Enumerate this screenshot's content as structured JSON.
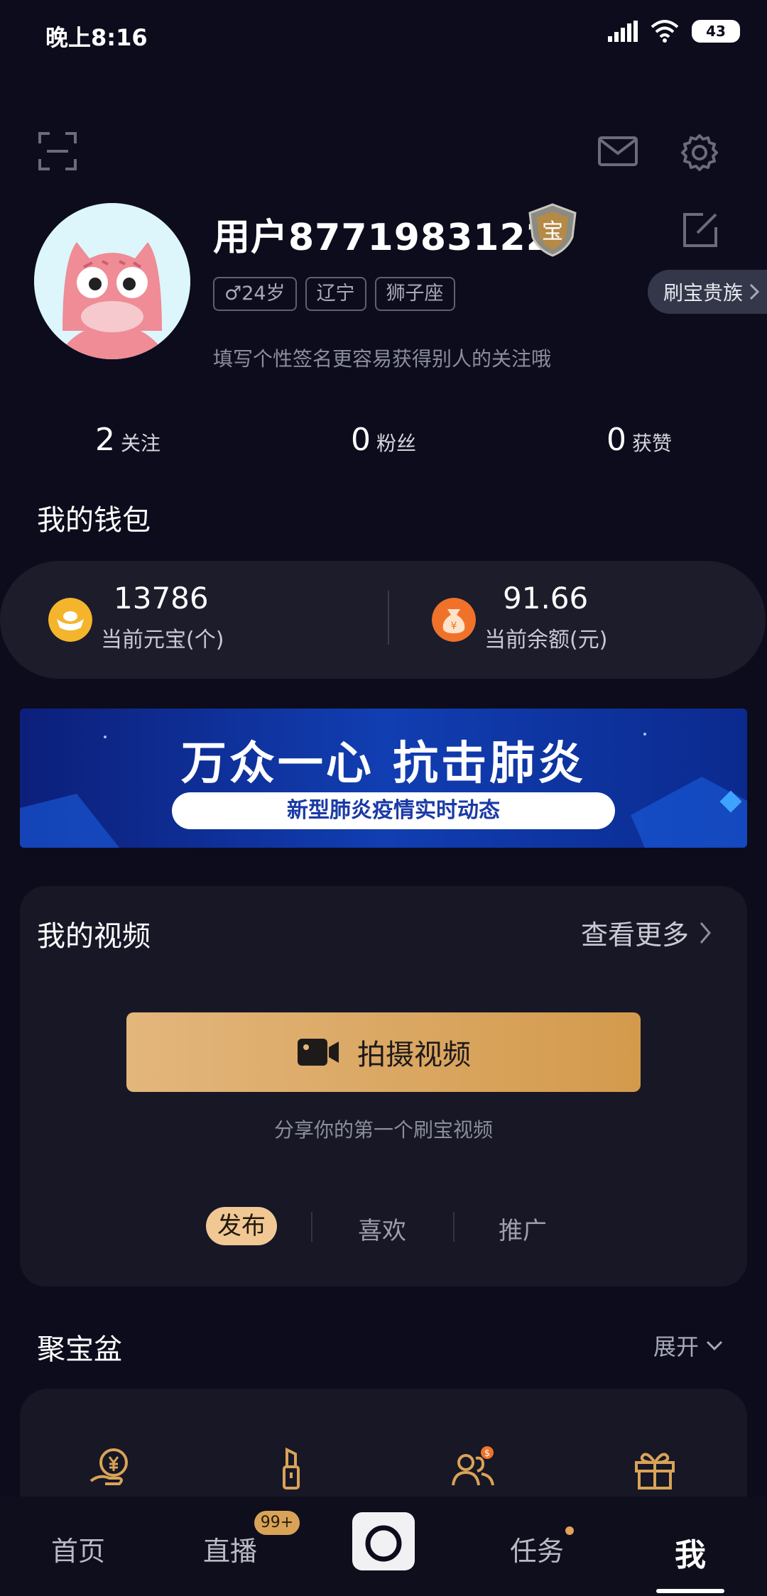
{
  "status_bar": {
    "time": "晚上8:16",
    "battery": "43"
  },
  "profile": {
    "username": "用户8771983122",
    "badge_text": "宝",
    "tags": [
      "♂24岁",
      "辽宁",
      "狮子座"
    ],
    "vip_label": "刷宝贵族",
    "signature": "填写个性签名更容易获得别人的关注哦"
  },
  "stats": [
    {
      "num": "2",
      "label": "关注"
    },
    {
      "num": "0",
      "label": "粉丝"
    },
    {
      "num": "0",
      "label": "获赞"
    }
  ],
  "wallet": {
    "title": "我的钱包",
    "coins_value": "13786",
    "coins_label": "当前元宝(个)",
    "balance_value": "91.66",
    "balance_label": "当前余额(元)",
    "money_bag_symbol": "¥"
  },
  "banner": {
    "title": "万众一心 抗击肺炎",
    "subtitle": "新型肺炎疫情实时动态"
  },
  "videos": {
    "title": "我的视频",
    "see_more": "查看更多",
    "shoot_label": "拍摄视频",
    "share_tip": "分享你的第一个刷宝视频",
    "tabs": [
      "发布",
      "喜欢",
      "推广"
    ]
  },
  "treasure": {
    "title": "聚宝盆",
    "expand": "展开",
    "icons": [
      "yuan-hand-icon",
      "lipstick-icon",
      "friends-money-icon",
      "gift-icon"
    ]
  },
  "bottom_nav": {
    "home": "首页",
    "live": "直播",
    "live_badge": "99+",
    "tasks": "任务",
    "me": "我"
  },
  "colors": {
    "background": "#0d0c1c",
    "card": "#171726",
    "gold": "#d9a357",
    "banner_blue": "#113eb2"
  }
}
